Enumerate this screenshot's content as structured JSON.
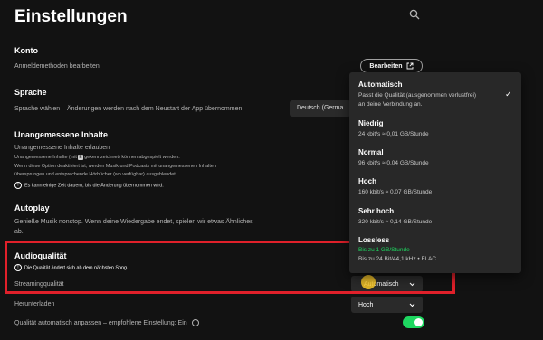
{
  "page_title": "Einstellungen",
  "account": {
    "heading": "Konto",
    "subtitle": "Anmeldemethoden bearbeiten",
    "edit_label": "Bearbeiten"
  },
  "language": {
    "heading": "Sprache",
    "subtitle": "Sprache wählen – Änderungen werden nach dem Neustart der App übernommen",
    "selected": "Deutsch (Germa"
  },
  "explicit": {
    "heading": "Unangemessene Inhalte",
    "subtitle": "Unangemessene Inhalte erlauben",
    "desc1_pre": "Unangemessene Inhalte (mit ",
    "badge": "E",
    "desc1_post": " gekennzeichnet) können abgespielt werden.",
    "desc2": "Wenn diese Option deaktiviert ist, werden Musik und Podcasts mit unangemessenen Inhalten",
    "desc3": "übersprungen und entsprechende Hörbücher (wo verfügbar) ausgeblendet.",
    "note": "Es kann einige Zeit dauern, bis die Änderung übernommen wird."
  },
  "autoplay": {
    "heading": "Autoplay",
    "line1": "Genieße Musik nonstop. Wenn deine Wiedergabe endet, spielen wir etwas Ähnliches",
    "line2": "ab."
  },
  "audio_quality": {
    "heading": "Audioqualität",
    "note": "Die Qualität ändert sich ab dem nächsten Song.",
    "streaming_label": "Streamingqualität",
    "streaming_value": "Automatisch",
    "download_label": "Herunterladen",
    "download_value": "Hoch",
    "auto_adjust_label": "Qualität automatisch anpassen – empfohlene Einstellung: Ein"
  },
  "quality_options": [
    {
      "title": "Automatisch",
      "desc": "Passt die Qualität (ausgenommen verlustfrei)",
      "desc2": "an deine Verbindung an.",
      "checked": true
    },
    {
      "title": "Niedrig",
      "desc": "24 kbit/s ≈ 0,01 GB/Stunde"
    },
    {
      "title": "Normal",
      "desc": "96 kbit/s ≈ 0,04 GB/Stunde"
    },
    {
      "title": "Hoch",
      "desc": "160 kbit/s ≈ 0,07 GB/Stunde"
    },
    {
      "title": "Sehr hoch",
      "desc": "320 kbit/s ≈ 0,14 GB/Stunde"
    },
    {
      "title": "Lossless",
      "desc": "Bis zu 1 GB/Stunde",
      "desc2": "Bis zu 24 Bit/44,1 kHz • FLAC"
    }
  ],
  "colors": {
    "accent": "#1ed760",
    "highlight_box": "#e0202a",
    "background": "#121212"
  },
  "icons": {
    "search": "search-icon",
    "external_link": "external-link-icon",
    "info": "info-icon",
    "check": "check-icon",
    "chevron": "chevron-down-icon"
  }
}
